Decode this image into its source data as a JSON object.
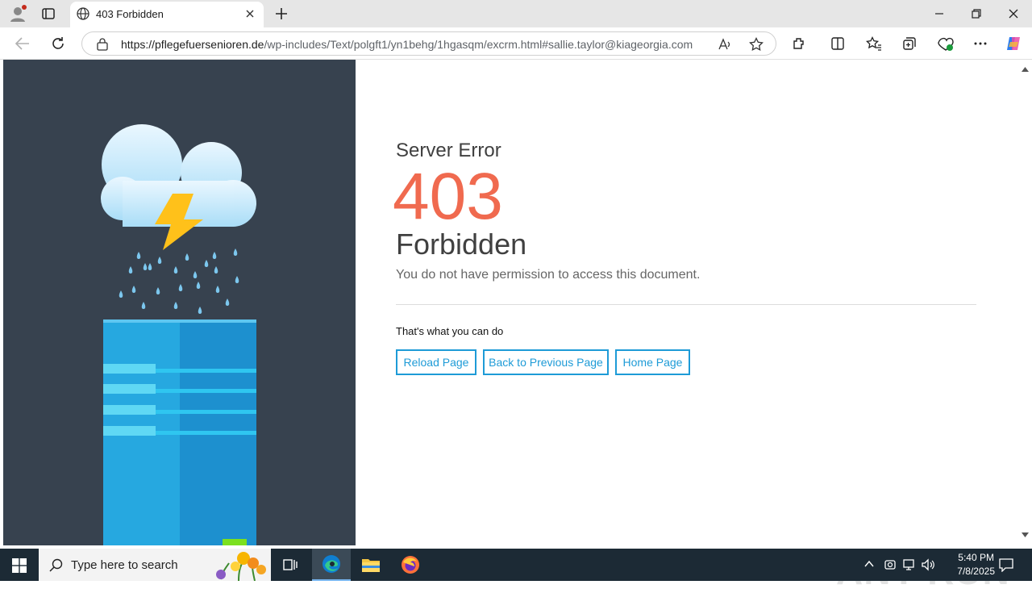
{
  "browser": {
    "tab_title": "403 Forbidden",
    "url_host": "https://pflegefuersenioren.de",
    "url_path": "/wp-includes/Text/polgft1/yn1behg/1hgasqm/excrm.html#sallie.taylor@kiageorgia.com"
  },
  "page": {
    "error_title": "Server Error",
    "error_code": "403",
    "error_name": "Forbidden",
    "error_desc": "You do not have permission to access this document.",
    "what_to_do": "That's what you can do",
    "buttons": {
      "reload": "Reload Page",
      "back": "Back to Previous Page",
      "home": "Home Page"
    },
    "colors": {
      "accent": "#1e9bd7",
      "code": "#f06a4f",
      "panel": "#37424f"
    }
  },
  "watermark": "ANY RUN",
  "taskbar": {
    "search_placeholder": "Type here to search",
    "time": "5:40 PM",
    "date": "7/8/2025"
  }
}
